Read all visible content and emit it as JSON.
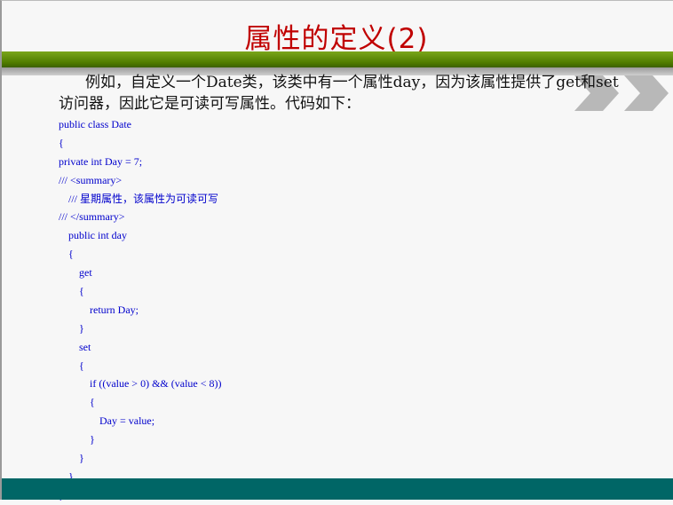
{
  "slide": {
    "title": "属性的定义(2)",
    "intro": "例如，自定义一个Date类，该类中有一个属性day，因为该属性提供了get和set访问器，因此它是可读可写属性。代码如下：",
    "code_lines": [
      {
        "indent": 0,
        "text": "public class Date"
      },
      {
        "indent": 0,
        "text": "{"
      },
      {
        "indent": 0,
        "text": "private int Day = 7;"
      },
      {
        "indent": 0,
        "text": "/// <summary>"
      },
      {
        "indent": 1,
        "text": "/// 星期属性，该属性为可读可写"
      },
      {
        "indent": 0,
        "text": "/// </summary>"
      },
      {
        "indent": 1,
        "text": "public int day"
      },
      {
        "indent": 1,
        "text": "{"
      },
      {
        "indent": 2,
        "text": "get"
      },
      {
        "indent": 2,
        "text": "{"
      },
      {
        "indent": 3,
        "text": "return Day;"
      },
      {
        "indent": 2,
        "text": "}"
      },
      {
        "indent": 2,
        "text": "set"
      },
      {
        "indent": 2,
        "text": "{"
      },
      {
        "indent": 3,
        "text": "if ((value > 0) && (value < 8))"
      },
      {
        "indent": 3,
        "text": "{"
      },
      {
        "indent": 4,
        "text": "Day = value;"
      },
      {
        "indent": 3,
        "text": "}"
      },
      {
        "indent": 2,
        "text": "}"
      },
      {
        "indent": 1,
        "text": "}"
      },
      {
        "indent": 0,
        "text": "}"
      }
    ]
  },
  "colors": {
    "title": "#c00000",
    "code": "#0000cc",
    "header_bar": "#4f7c00",
    "footer_bar": "#006666"
  },
  "icons": [
    "chevron-right-icon",
    "chevron-right-icon"
  ]
}
